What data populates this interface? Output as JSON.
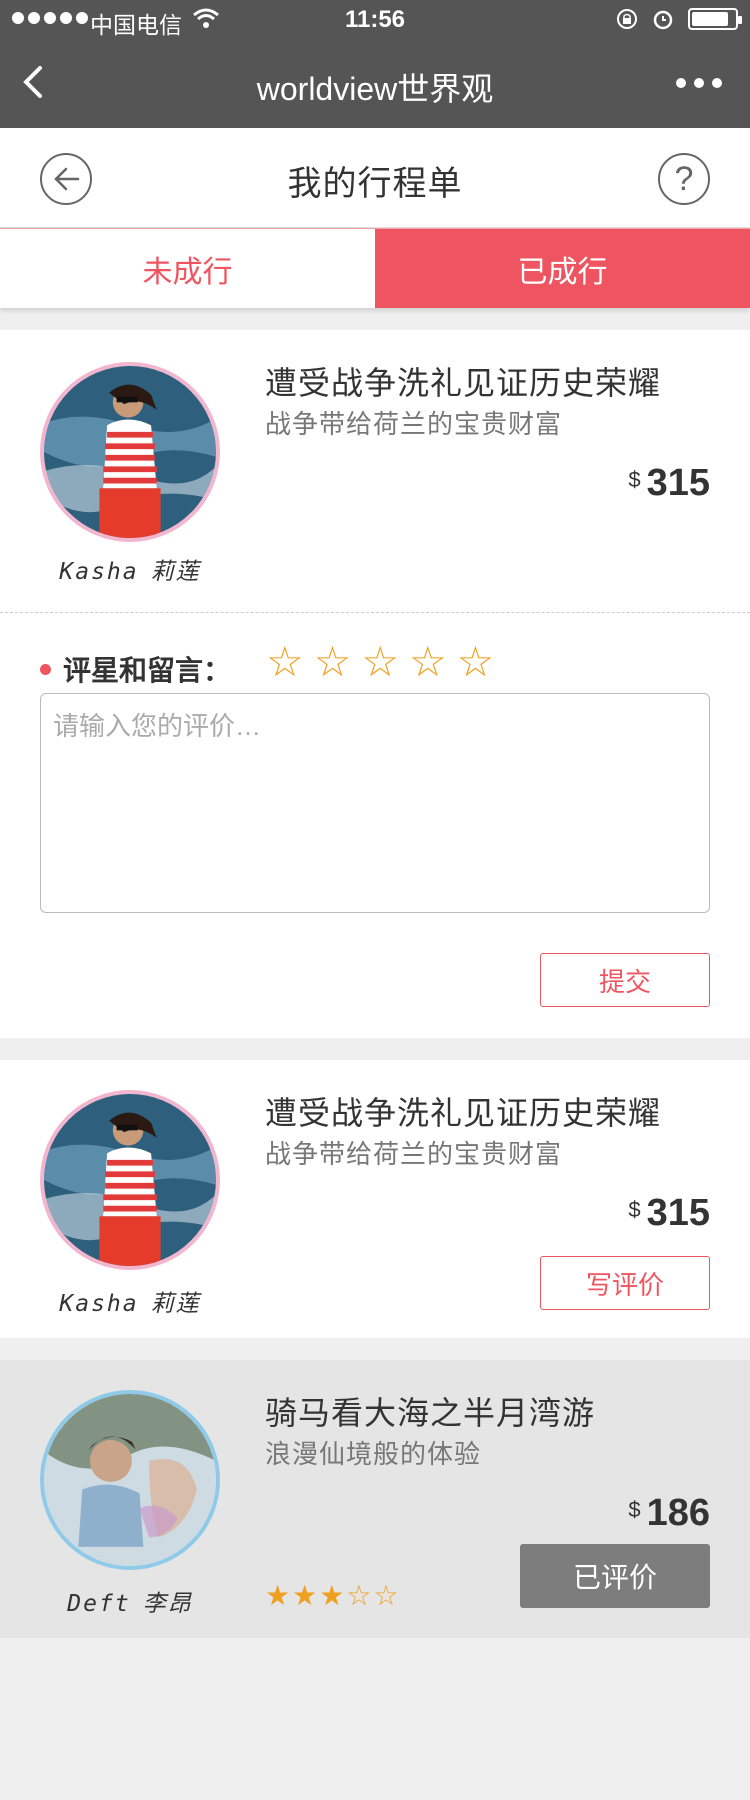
{
  "status_bar": {
    "carrier": "中国电信",
    "time": "11:56"
  },
  "nav": {
    "title": "worldview世界观"
  },
  "header": {
    "title": "我的行程单",
    "help": "?"
  },
  "tabs": [
    {
      "label": "未成行",
      "active": false
    },
    {
      "label": "已成行",
      "active": true
    }
  ],
  "trips": [
    {
      "guide": "Kasha",
      "guide_cn": "莉莲",
      "title": "遭受战争洗礼见证历史荣耀",
      "subtitle": "战争带给荷兰的宝贵财富",
      "currency": "$",
      "price": "315"
    },
    {
      "guide": "Kasha",
      "guide_cn": "莉莲",
      "title": "遭受战争洗礼见证历史荣耀",
      "subtitle": "战争带给荷兰的宝贵财富",
      "currency": "$",
      "price": "315",
      "action": "写评价"
    },
    {
      "guide": "Deft",
      "guide_cn": "李昂",
      "title": "骑马看大海之半月湾游",
      "subtitle": "浪漫仙境般的体验",
      "currency": "$",
      "price": "186",
      "action": "已评价",
      "rating": 3,
      "rating_max": 5
    }
  ],
  "review": {
    "label": "评星和留言：",
    "placeholder": "请输入您的评价…",
    "submit": "提交",
    "star_count": 5
  },
  "colors": {
    "accent": "#ef5560",
    "star": "#f0a020",
    "navbar": "#555555"
  }
}
